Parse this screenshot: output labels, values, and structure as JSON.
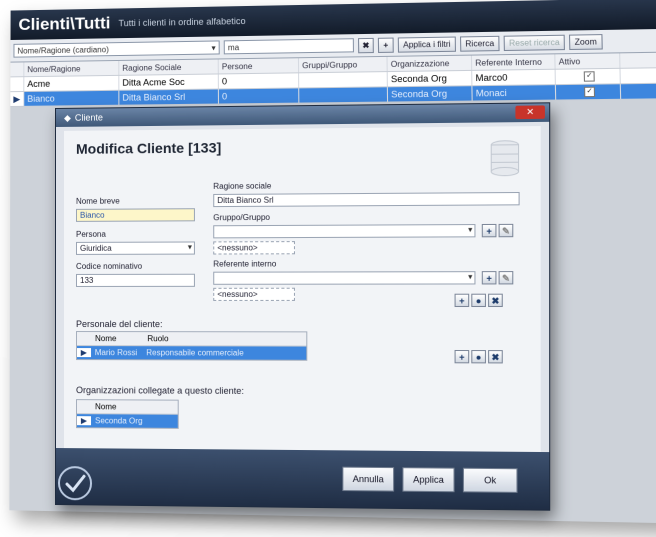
{
  "app": {
    "title": "Clienti\\Tutti",
    "subtitle": "Tutti i clienti in ordine alfabetico"
  },
  "toolbar": {
    "view_select": "Nome/Ragione (cardiano)",
    "filter_value": "ma",
    "apply_filter_label": "Applica i filtri",
    "reset_label": "Ricerca",
    "reset_disabled_label": "Reset ricerca",
    "zoom_label": "Zoom"
  },
  "grid": {
    "headers": [
      "Nome/Ragione",
      "Ragione Sociale",
      "Persone",
      "Gruppi/Gruppo",
      "Organizzazione",
      "Referente Interno",
      "Attivo"
    ],
    "rows": [
      {
        "name": "Acme",
        "company": "Ditta Acme Soc",
        "persons": "0",
        "group": "",
        "org": "Seconda Org",
        "ref": "Marco0",
        "active": "✓"
      },
      {
        "name": "Bianco",
        "company": "Ditta Bianco Srl",
        "persons": "0",
        "group": "",
        "org": "Seconda Org",
        "ref": "Monaci",
        "active": "✓"
      }
    ]
  },
  "dialog": {
    "window_title": "Cliente",
    "heading": "Modifica Cliente [133]",
    "close_icon": "close-icon",
    "fields": {
      "nome_label": "Nome breve",
      "nome_value": "Bianco",
      "ragione_label": "Ragione sociale",
      "ragione_value": "Ditta Bianco Srl",
      "persona_label": "Persona",
      "persona_value": "Giuridica",
      "codice_label": "Codice nominativo",
      "codice_value": "133",
      "gruppo_label": "Gruppo/Gruppo",
      "gruppo_value": "",
      "gruppo_tag": "<nessuno>",
      "referente_label": "Referente interno",
      "referente_value": "",
      "referente_tag": "<nessuno>"
    },
    "persons": {
      "title": "Personale del cliente:",
      "headers": [
        "Nome",
        "Ruolo"
      ],
      "rows": [
        {
          "name": "Mario Rossi",
          "role": "Responsabile commerciale"
        }
      ]
    },
    "orgs": {
      "title": "Organizzazioni collegate a questo cliente:",
      "headers": [
        "Nome"
      ],
      "rows": [
        {
          "name": "Seconda Org"
        }
      ]
    },
    "buttons": {
      "annulla": "Annulla",
      "applica": "Applica",
      "ok": "Ok"
    }
  },
  "icons": {
    "add": "+",
    "edit": "✎",
    "view": "●",
    "delete": "✖",
    "check": "✓",
    "row_marker": "▶"
  },
  "colors": {
    "titlebar": "#1a2436",
    "selection": "#3d86de",
    "footer": "#2c3d58"
  }
}
